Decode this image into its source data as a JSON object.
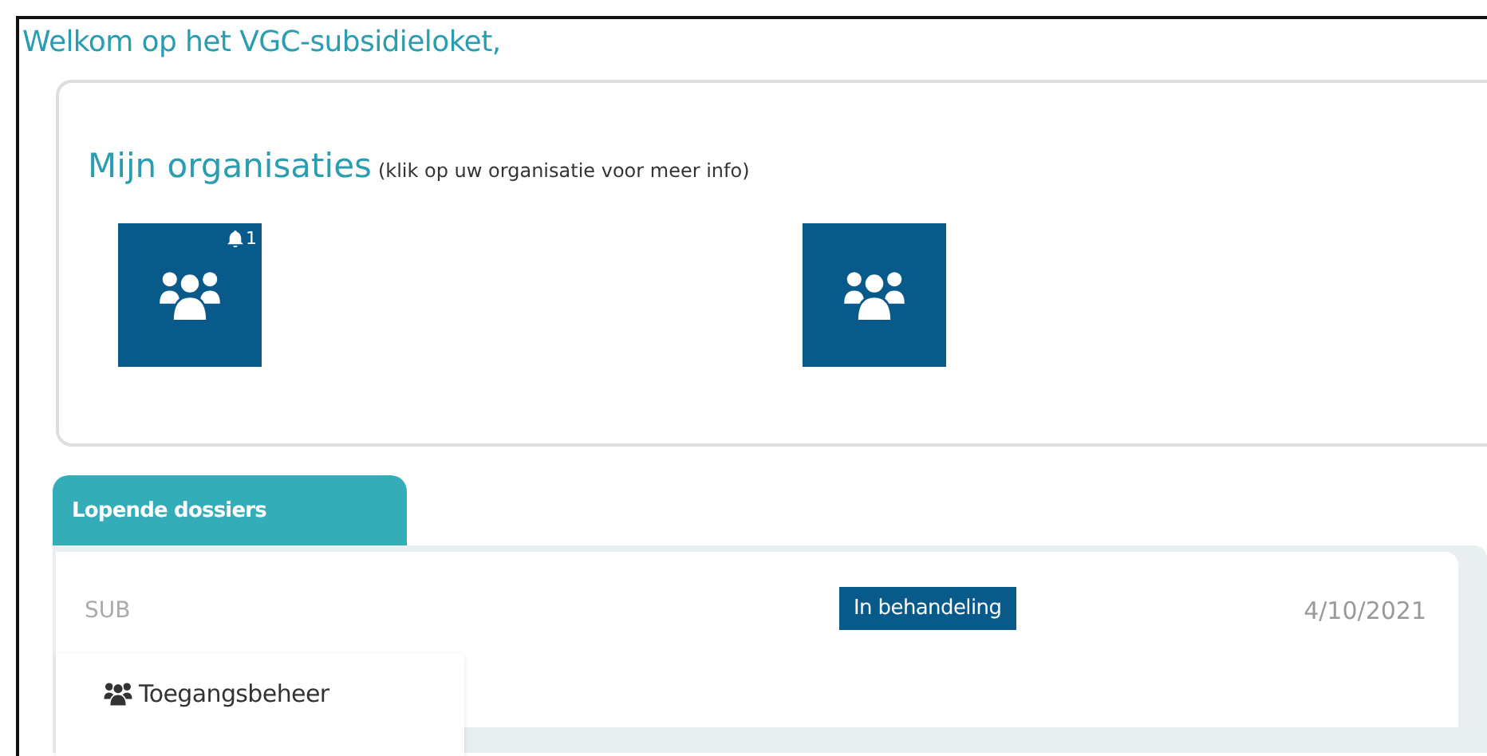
{
  "welcome": "Welkom op het VGC-subsidieloket,",
  "organisations": {
    "title": "Mijn organisaties",
    "hint": "(klik op uw organisatie voor meer info)",
    "items": [
      {
        "notified": true,
        "notifications": "1"
      },
      {
        "notified": false
      }
    ]
  },
  "tab": {
    "label": "Lopende dossiers",
    "selected": true
  },
  "dossiers": [
    {
      "prefix": "SUB",
      "status": "In behandeling",
      "date": "4/10/2021"
    }
  ],
  "menu": [
    {
      "label": "Toegangsbeheer"
    }
  ]
}
